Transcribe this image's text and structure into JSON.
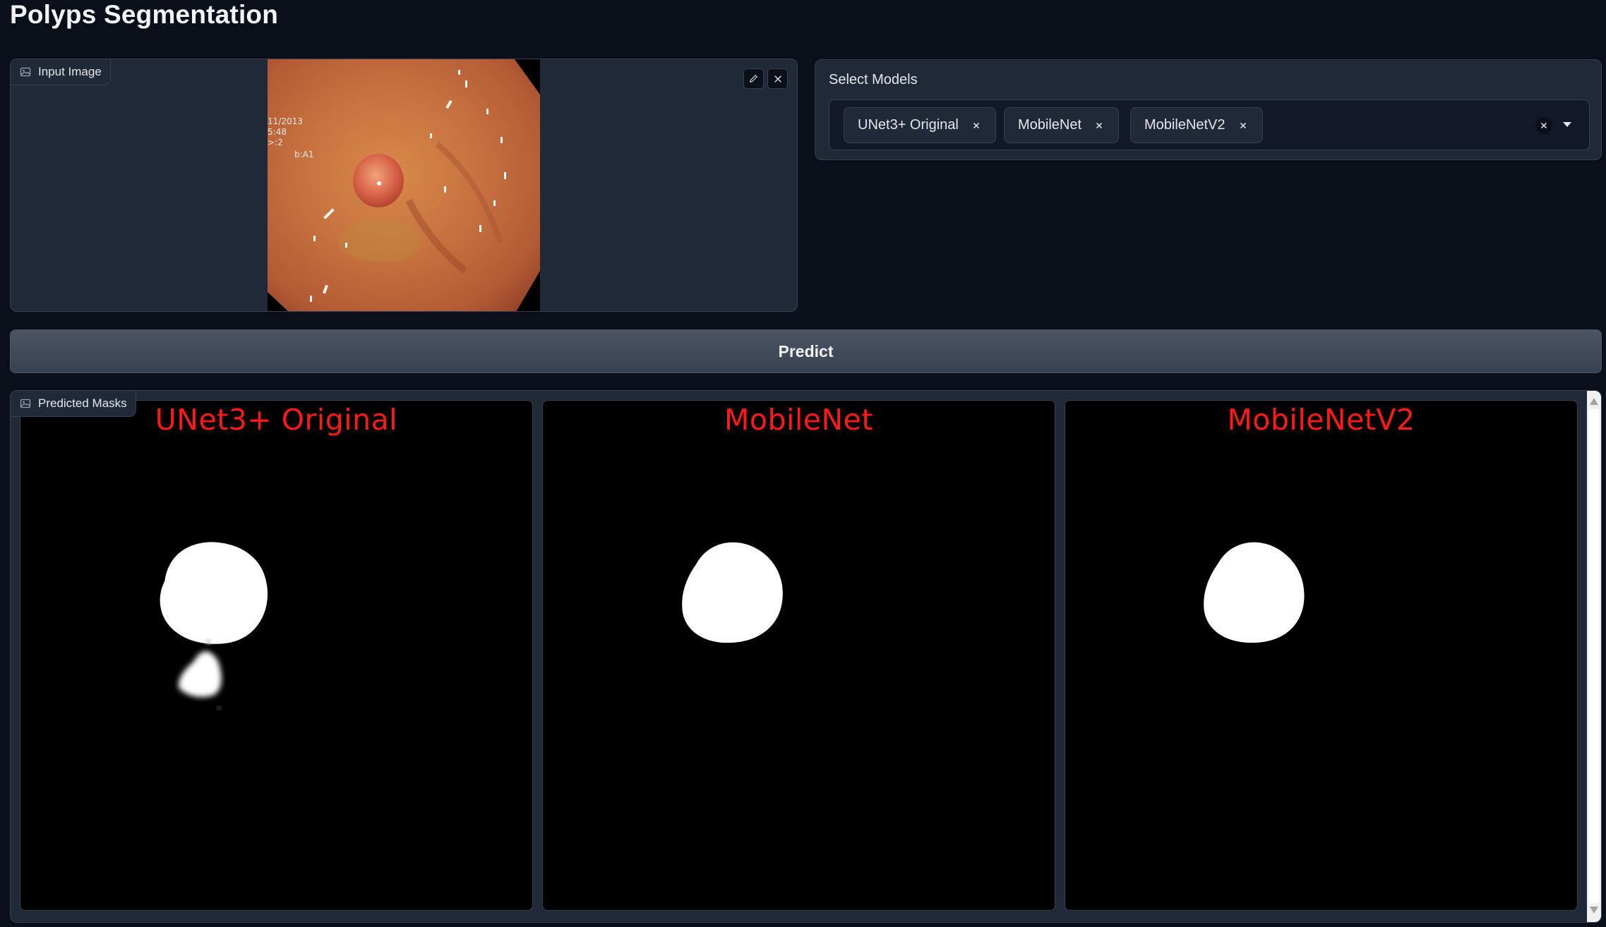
{
  "app": {
    "title": "Polyps Segmentation"
  },
  "input": {
    "label": "Input Image",
    "label_icon": "image-icon",
    "image_overlay_lines": [
      "11/2013",
      "5:48",
      ">:2",
      "b:A1"
    ],
    "edit_icon": "pencil-icon",
    "clear_icon": "close-icon"
  },
  "models": {
    "label": "Select Models",
    "selected": [
      {
        "label": "UNet3+ Original"
      },
      {
        "label": "MobileNet"
      },
      {
        "label": "MobileNetV2"
      }
    ],
    "clear_icon": "close-icon",
    "dropdown_icon": "caret-down-icon"
  },
  "predict": {
    "label": "Predict"
  },
  "output": {
    "label": "Predicted Masks",
    "label_icon": "image-icon",
    "masks": [
      {
        "caption": "UNet3+  Original"
      },
      {
        "caption": "MobileNet"
      },
      {
        "caption": "MobileNetV2"
      }
    ]
  },
  "colors": {
    "background": "#0b0f19",
    "panel": "#1f2937",
    "border": "#374151",
    "caption_red": "#ff1a1a"
  }
}
